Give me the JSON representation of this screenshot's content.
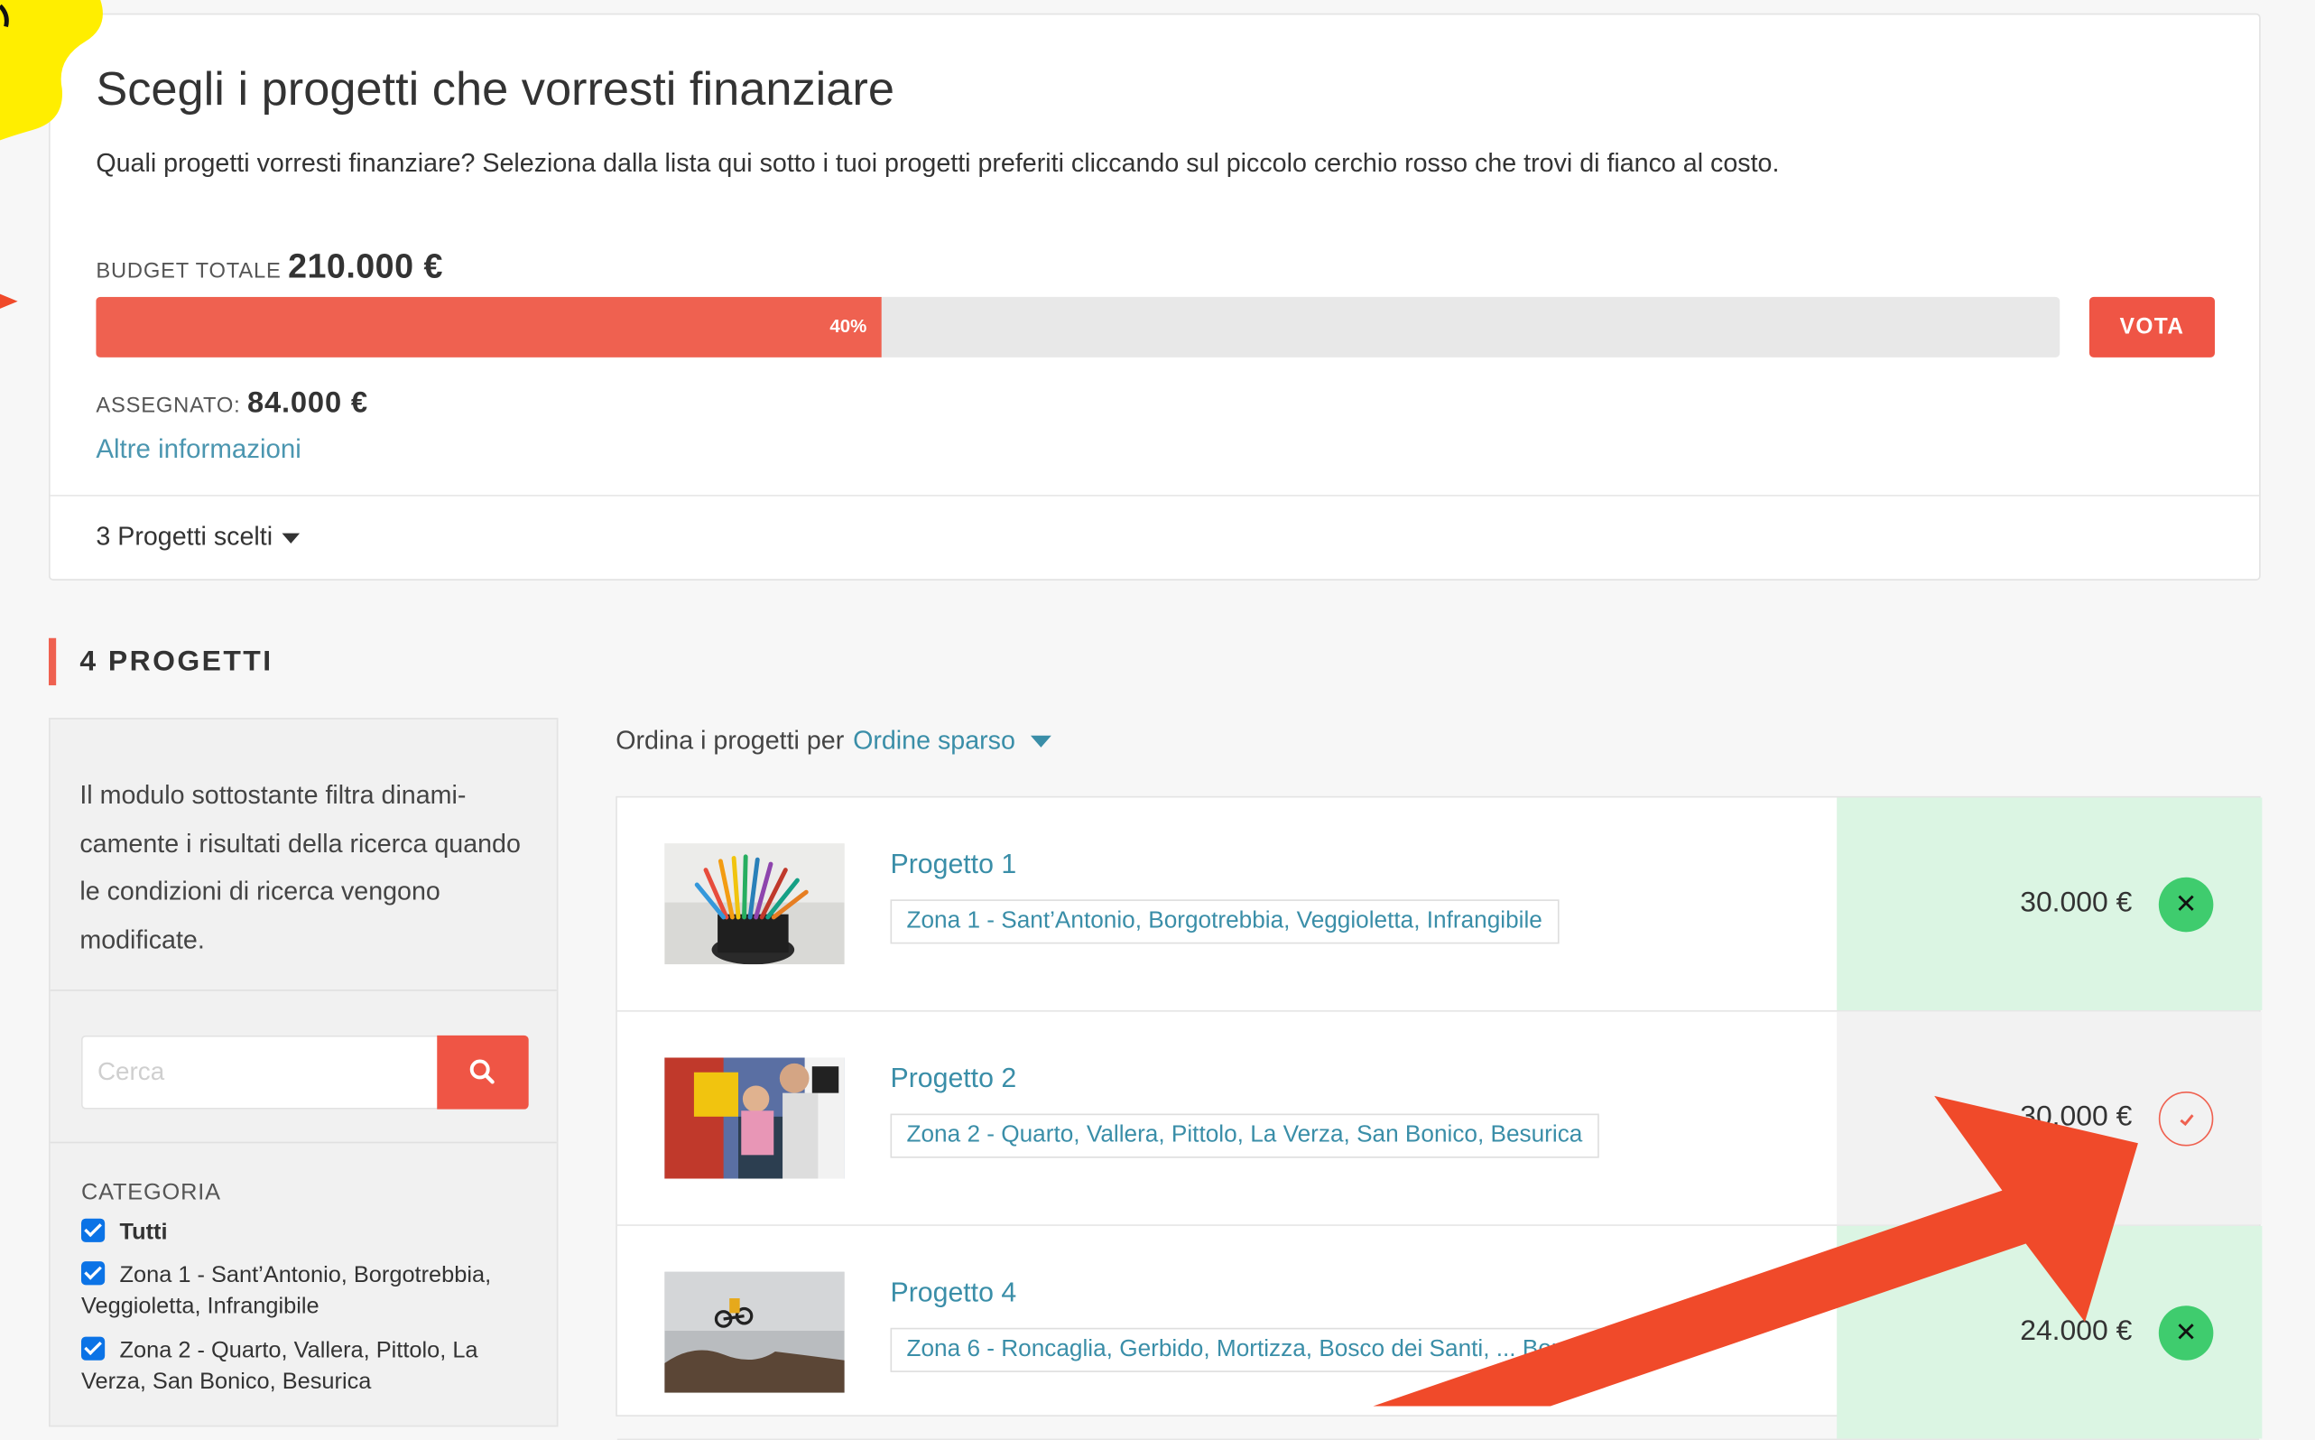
{
  "header": {
    "title": "Scegli i progetti che vorresti finanziare",
    "description": "Quali progetti vorresti finanziare? Seleziona dalla lista qui sotto i tuoi progetti preferiti cliccando sul piccolo cerchio rosso che trovi di fianco al costo."
  },
  "budget": {
    "total_label": "BUDGET TOTALE",
    "total_value": "210.000 €",
    "progress_percent": 40,
    "progress_label": "40%",
    "vote_button": "VOTA",
    "assigned_label": "ASSEGNATO:",
    "assigned_value": "84.000 €",
    "more_info_link": "Altre informazioni",
    "chosen_toggle": "3 Progetti scelti"
  },
  "section": {
    "title": "4 PROGETTI"
  },
  "sidebar": {
    "intro_text": "Il modulo sottostante filtra dinami-camente i risultati della ricerca quando le condizioni di ricerca vengono modificate.",
    "search_placeholder": "Cerca",
    "category_title": "CATEGORIA",
    "categories": [
      {
        "label": "Tutti",
        "checked": true
      },
      {
        "label": "Zona 1 - Sant’Antonio, Borgotrebbia, Veggioletta, Infrangibile",
        "checked": true
      },
      {
        "label": "Zona 2 - Quarto, Vallera, Pittolo, La Verza, San Bonico, Besurica",
        "checked": true
      }
    ]
  },
  "sort": {
    "label": "Ordina i progetti per",
    "value": "Ordine sparso"
  },
  "projects": [
    {
      "name": "Progetto 1",
      "zone": "Zona 1 - Sant’Antonio, Borgotrebbia, Veggioletta, Infrangibile",
      "cost": "30.000 €",
      "selected": true,
      "icon": "close-icon"
    },
    {
      "name": "Progetto 2",
      "zone": "Zona 2 - Quarto, Vallera, Pittolo, La Verza, San Bonico, Besurica",
      "cost": "30.000 €",
      "selected": false,
      "icon": "check-icon"
    },
    {
      "name": "Progetto 4",
      "zone": "Zona 6 - Roncaglia, Gerbido, Mortizza, Bosco dei Santi, ... Borghetto",
      "cost": "24.000 €",
      "selected": true,
      "icon": "close-icon"
    }
  ],
  "colors": {
    "accent": "#ef6150",
    "link": "#3a8ea8",
    "selected_bg": "#dbf5e3",
    "annotation_arrow": "#f04a2a",
    "annotation_blob": "#ffee00"
  }
}
